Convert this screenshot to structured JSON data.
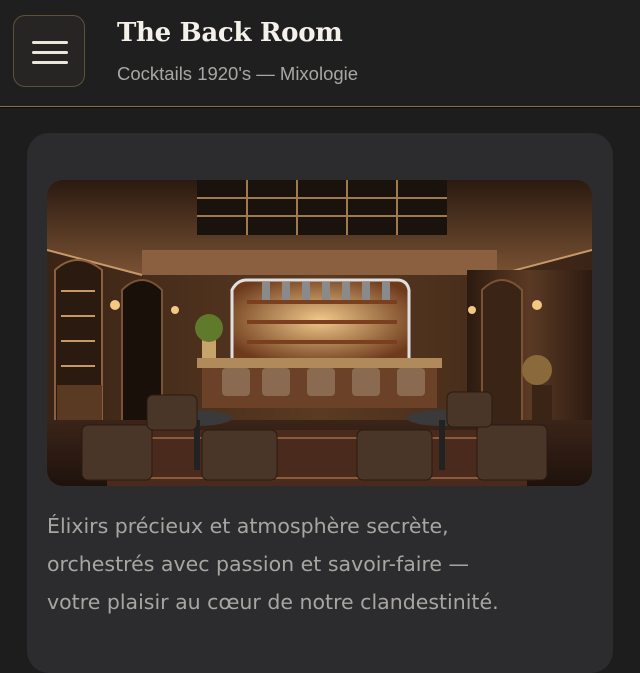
{
  "header": {
    "menu_icon": "hamburger-menu-icon",
    "title": "The Back Room",
    "subtitle": "Cocktails 1920's — Mixologie"
  },
  "card": {
    "image_alt": "bar-interior-photo",
    "description_lines": [
      "Élixirs précieux et atmosphère secrète,",
      "orchestrés avec passion et savoir-faire —",
      "votre plaisir au cœur de notre clandestinité."
    ]
  },
  "colors": {
    "background": "#1d1d1e",
    "card": "#2c2c2e",
    "accent_gold": "#8a7346",
    "title": "#f4f1ea",
    "muted_text": "#a8a6a2"
  }
}
